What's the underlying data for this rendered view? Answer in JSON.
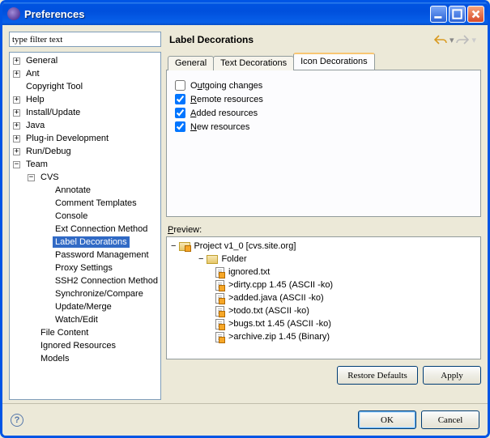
{
  "window": {
    "title": "Preferences"
  },
  "filter": {
    "placeholder": "type filter text"
  },
  "tree": {
    "items": [
      {
        "label": "General",
        "lvl": 1,
        "exp": "+"
      },
      {
        "label": "Ant",
        "lvl": 1,
        "exp": "+"
      },
      {
        "label": "Copyright Tool",
        "lvl": 1,
        "exp": ""
      },
      {
        "label": "Help",
        "lvl": 1,
        "exp": "+"
      },
      {
        "label": "Install/Update",
        "lvl": 1,
        "exp": "+"
      },
      {
        "label": "Java",
        "lvl": 1,
        "exp": "+"
      },
      {
        "label": "Plug-in Development",
        "lvl": 1,
        "exp": "+"
      },
      {
        "label": "Run/Debug",
        "lvl": 1,
        "exp": "+"
      },
      {
        "label": "Team",
        "lvl": 1,
        "exp": "-"
      },
      {
        "label": "CVS",
        "lvl": 2,
        "exp": "-"
      },
      {
        "label": "Annotate",
        "lvl": 3,
        "exp": ""
      },
      {
        "label": "Comment Templates",
        "lvl": 3,
        "exp": ""
      },
      {
        "label": "Console",
        "lvl": 3,
        "exp": ""
      },
      {
        "label": "Ext Connection Method",
        "lvl": 3,
        "exp": ""
      },
      {
        "label": "Label Decorations",
        "lvl": 3,
        "exp": "",
        "selected": true
      },
      {
        "label": "Password Management",
        "lvl": 3,
        "exp": ""
      },
      {
        "label": "Proxy Settings",
        "lvl": 3,
        "exp": ""
      },
      {
        "label": "SSH2 Connection Method",
        "lvl": 3,
        "exp": ""
      },
      {
        "label": "Synchronize/Compare",
        "lvl": 3,
        "exp": ""
      },
      {
        "label": "Update/Merge",
        "lvl": 3,
        "exp": ""
      },
      {
        "label": "Watch/Edit",
        "lvl": 3,
        "exp": ""
      },
      {
        "label": "File Content",
        "lvl": 2,
        "exp": ""
      },
      {
        "label": "Ignored Resources",
        "lvl": 2,
        "exp": ""
      },
      {
        "label": "Models",
        "lvl": 2,
        "exp": ""
      }
    ]
  },
  "page": {
    "title": "Label Decorations",
    "tabs": {
      "t0": "General",
      "t1": "Text Decorations",
      "t2": "Icon Decorations"
    },
    "checks": {
      "c0": {
        "pre": "O",
        "u": "u",
        "post": "tgoing changes",
        "checked": false
      },
      "c1": {
        "pre": "",
        "u": "R",
        "post": "emote resources",
        "checked": true
      },
      "c2": {
        "pre": "",
        "u": "A",
        "post": "dded resources",
        "checked": true
      },
      "c3": {
        "pre": "",
        "u": "N",
        "post": "ew resources",
        "checked": true
      }
    },
    "previewLabel": "Preview:",
    "preview": [
      {
        "lvl": 1,
        "kind": "project",
        "exp": "-",
        "text": "Project  v1_0 [cvs.site.org]"
      },
      {
        "lvl": 2,
        "kind": "folder",
        "exp": "-",
        "text": "Folder"
      },
      {
        "lvl": 3,
        "kind": "file",
        "text": "ignored.txt"
      },
      {
        "lvl": 3,
        "kind": "file",
        "text": ">dirty.cpp  1.45  (ASCII -ko)"
      },
      {
        "lvl": 3,
        "kind": "file",
        "text": ">added.java    (ASCII -ko)"
      },
      {
        "lvl": 3,
        "kind": "file",
        "text": ">todo.txt    (ASCII -ko)"
      },
      {
        "lvl": 3,
        "kind": "file",
        "text": ">bugs.txt  1.45  (ASCII -ko)"
      },
      {
        "lvl": 3,
        "kind": "file",
        "text": ">archive.zip  1.45  (Binary)"
      }
    ],
    "buttons": {
      "restore": "Restore Defaults",
      "apply": "Apply"
    }
  },
  "dialog": {
    "ok": "OK",
    "cancel": "Cancel"
  }
}
